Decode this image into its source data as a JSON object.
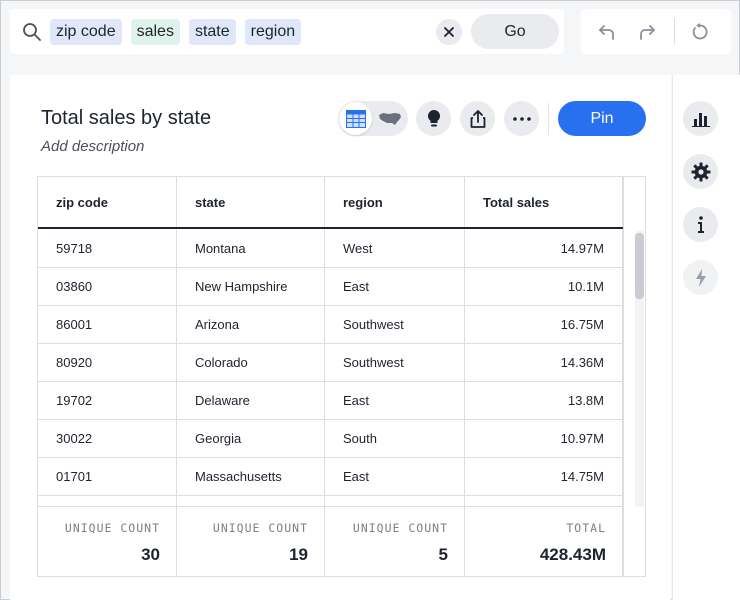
{
  "search": {
    "tokens": [
      {
        "text": "zip code",
        "kind": "attribute"
      },
      {
        "text": "sales",
        "kind": "measure"
      },
      {
        "text": "state",
        "kind": "attribute"
      },
      {
        "text": "region",
        "kind": "attribute"
      }
    ],
    "go_label": "Go",
    "icons": {
      "search": "search-icon",
      "clear": "close-icon"
    }
  },
  "history": {
    "icons": [
      "undo-icon",
      "redo-icon",
      "reset-icon"
    ]
  },
  "answer": {
    "title": "Total sales by state",
    "description_placeholder": "Add description",
    "pin_label": "Pin",
    "toolbar_icons": [
      "table-icon",
      "map-icon",
      "lightbulb-icon",
      "share-icon",
      "more-icon"
    ]
  },
  "table": {
    "columns": [
      "zip code",
      "state",
      "region",
      "Total sales"
    ],
    "rows": [
      [
        "59718",
        "Montana",
        "West",
        "14.97M"
      ],
      [
        "03860",
        "New Hampshire",
        "East",
        "10.1M"
      ],
      [
        "86001",
        "Arizona",
        "Southwest",
        "16.75M"
      ],
      [
        "80920",
        "Colorado",
        "Southwest",
        "14.36M"
      ],
      [
        "19702",
        "Delaware",
        "East",
        "13.8M"
      ],
      [
        "30022",
        "Georgia",
        "South",
        "10.97M"
      ],
      [
        "01701",
        "Massachusetts",
        "East",
        "14.75M"
      ]
    ],
    "footer": [
      {
        "label": "UNIQUE COUNT",
        "value": "30"
      },
      {
        "label": "UNIQUE COUNT",
        "value": "19"
      },
      {
        "label": "UNIQUE COUNT",
        "value": "5"
      },
      {
        "label": "TOTAL",
        "value": "428.43M"
      }
    ]
  },
  "rail": {
    "icons": [
      "chart-icon",
      "gear-icon",
      "info-icon",
      "lightning-icon"
    ]
  },
  "colors": {
    "primary": "#2770ef",
    "attribute_token": "#dfe7f8",
    "measure_token": "#dff3ea"
  }
}
